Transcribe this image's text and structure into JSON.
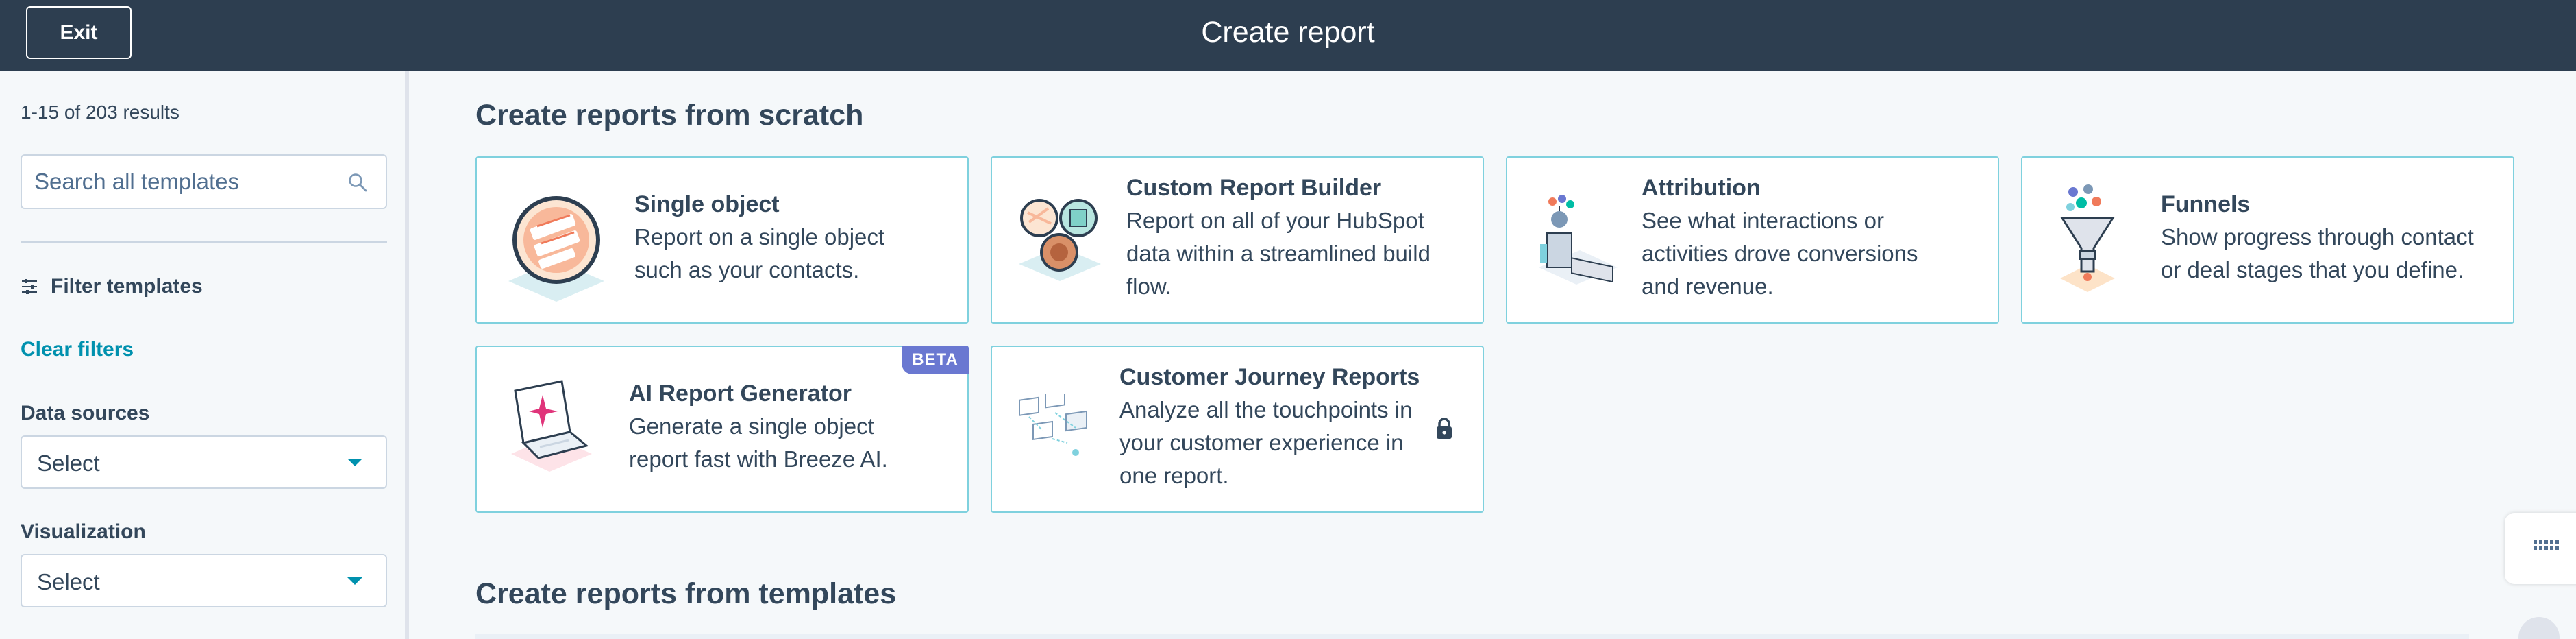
{
  "header": {
    "exit_label": "Exit",
    "title": "Create report"
  },
  "sidebar": {
    "results_text": "1-15 of 203 results",
    "search_placeholder": "Search all templates",
    "filter_label": "Filter templates",
    "clear_filters": "Clear filters",
    "data_sources_label": "Data sources",
    "data_sources_value": "Select",
    "visualization_label": "Visualization",
    "visualization_value": "Select"
  },
  "main": {
    "scratch_title": "Create reports from scratch",
    "templates_title": "Create reports from templates",
    "cards": [
      {
        "title": "Single object",
        "desc": [
          "Report on a single object",
          "such as your contacts."
        ],
        "illustration": "single-object-illustration"
      },
      {
        "title": "Custom Report Builder",
        "desc": [
          "Report on all of your HubSpot",
          "data within a streamlined build",
          "flow."
        ],
        "illustration": "custom-report-builder-illustration"
      },
      {
        "title": "Attribution",
        "desc": [
          "See what interactions or",
          "activities drove conversions",
          "and revenue."
        ],
        "illustration": "attribution-illustration"
      },
      {
        "title": "Funnels",
        "desc": [
          "Show progress through contact",
          "or deal stages that you define."
        ],
        "illustration": "funnel-illustration"
      },
      {
        "title": "AI Report Generator",
        "desc": [
          "Generate a single object",
          "report fast with Breeze AI."
        ],
        "illustration": "ai-laptop-illustration",
        "badge": "BETA"
      },
      {
        "title": "Customer Journey Reports",
        "desc": [
          "Analyze all the touchpoints in",
          "your customer experience in",
          "one report."
        ],
        "illustration": "customer-journey-illustration",
        "icon": "lock-icon"
      }
    ]
  },
  "colors": {
    "header_bg": "#2d3e50",
    "card_border": "#7fd1de",
    "link": "#0091ae",
    "beta": "#6a78d1"
  }
}
